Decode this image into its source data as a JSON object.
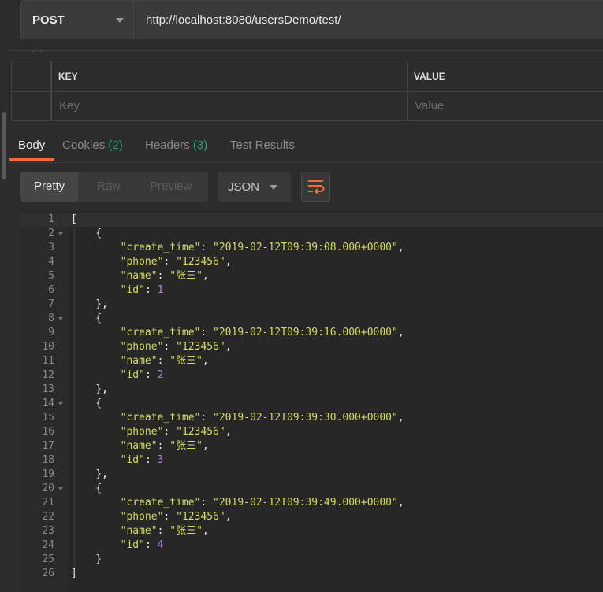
{
  "request": {
    "method": "POST",
    "url": "http://localhost:8080/usersDemo/test/"
  },
  "params_table": {
    "key_header": "KEY",
    "value_header": "VALUE",
    "key_placeholder": "Key",
    "value_placeholder": "Value"
  },
  "response_tabs": [
    {
      "label": "Body",
      "count": ""
    },
    {
      "label": "Cookies",
      "count": "(2)"
    },
    {
      "label": "Headers",
      "count": "(3)"
    },
    {
      "label": "Test Results",
      "count": ""
    }
  ],
  "view_modes": [
    "Pretty",
    "Raw",
    "Preview"
  ],
  "format": "JSON",
  "colors": {
    "accent": "#f26b3a",
    "count": "#2ea37d",
    "json_string": "#d6dc5e",
    "json_number": "#b07fe0"
  },
  "icons": {
    "wrap": "text-wrap-icon",
    "dropdown": "chevron-down-icon",
    "fold": "fold-arrow-icon"
  },
  "code_lines": [
    {
      "n": "1",
      "fold": false,
      "html": "["
    },
    {
      "n": "2",
      "fold": true,
      "html": "    {"
    },
    {
      "n": "3",
      "fold": false,
      "html": "        <span class=\"k\">\"create_time\"</span>: <span class=\"s\">\"2019-02-12T09:39:08.000+0000\"</span>,"
    },
    {
      "n": "4",
      "fold": false,
      "html": "        <span class=\"k\">\"phone\"</span>: <span class=\"s\">\"123456\"</span>,"
    },
    {
      "n": "5",
      "fold": false,
      "html": "        <span class=\"k\">\"name\"</span>: <span class=\"s\">\"张三\"</span>,"
    },
    {
      "n": "6",
      "fold": false,
      "html": "        <span class=\"k\">\"id\"</span>: <span class=\"n\">1</span>"
    },
    {
      "n": "7",
      "fold": false,
      "html": "    },"
    },
    {
      "n": "8",
      "fold": true,
      "html": "    {"
    },
    {
      "n": "9",
      "fold": false,
      "html": "        <span class=\"k\">\"create_time\"</span>: <span class=\"s\">\"2019-02-12T09:39:16.000+0000\"</span>,"
    },
    {
      "n": "10",
      "fold": false,
      "html": "        <span class=\"k\">\"phone\"</span>: <span class=\"s\">\"123456\"</span>,"
    },
    {
      "n": "11",
      "fold": false,
      "html": "        <span class=\"k\">\"name\"</span>: <span class=\"s\">\"张三\"</span>,"
    },
    {
      "n": "12",
      "fold": false,
      "html": "        <span class=\"k\">\"id\"</span>: <span class=\"n\">2</span>"
    },
    {
      "n": "13",
      "fold": false,
      "html": "    },"
    },
    {
      "n": "14",
      "fold": true,
      "html": "    {"
    },
    {
      "n": "15",
      "fold": false,
      "html": "        <span class=\"k\">\"create_time\"</span>: <span class=\"s\">\"2019-02-12T09:39:30.000+0000\"</span>,"
    },
    {
      "n": "16",
      "fold": false,
      "html": "        <span class=\"k\">\"phone\"</span>: <span class=\"s\">\"123456\"</span>,"
    },
    {
      "n": "17",
      "fold": false,
      "html": "        <span class=\"k\">\"name\"</span>: <span class=\"s\">\"张三\"</span>,"
    },
    {
      "n": "18",
      "fold": false,
      "html": "        <span class=\"k\">\"id\"</span>: <span class=\"n\">3</span>"
    },
    {
      "n": "19",
      "fold": false,
      "html": "    },"
    },
    {
      "n": "20",
      "fold": true,
      "html": "    {"
    },
    {
      "n": "21",
      "fold": false,
      "html": "        <span class=\"k\">\"create_time\"</span>: <span class=\"s\">\"2019-02-12T09:39:49.000+0000\"</span>,"
    },
    {
      "n": "22",
      "fold": false,
      "html": "        <span class=\"k\">\"phone\"</span>: <span class=\"s\">\"123456\"</span>,"
    },
    {
      "n": "23",
      "fold": false,
      "html": "        <span class=\"k\">\"name\"</span>: <span class=\"s\">\"张三\"</span>,"
    },
    {
      "n": "24",
      "fold": false,
      "html": "        <span class=\"k\">\"id\"</span>: <span class=\"n\">4</span>"
    },
    {
      "n": "25",
      "fold": false,
      "html": "    }"
    },
    {
      "n": "26",
      "fold": false,
      "html": "]"
    }
  ]
}
